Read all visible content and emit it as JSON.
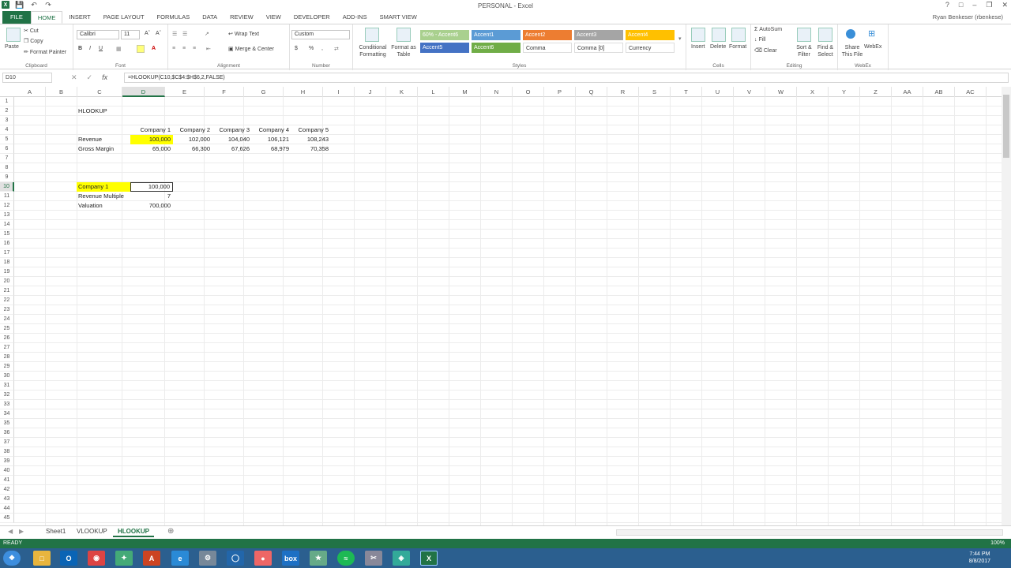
{
  "window": {
    "title": "PERSONAL - Excel",
    "user": "Ryan Benkeser (rbenkese)"
  },
  "ribbon_tabs": [
    "FILE",
    "HOME",
    "INSERT",
    "PAGE LAYOUT",
    "FORMULAS",
    "DATA",
    "REVIEW",
    "VIEW",
    "DEVELOPER",
    "ADD-INS",
    "SMART VIEW"
  ],
  "clipboard": {
    "paste": "Paste",
    "cut": "Cut",
    "copy": "Copy",
    "painter": "Format Painter",
    "label": "Clipboard"
  },
  "font": {
    "name": "Calibri",
    "size": "11",
    "label": "Font",
    "bold": "B",
    "italic": "I",
    "underline": "U",
    "color": "A"
  },
  "alignment": {
    "wrap": "Wrap Text",
    "merge": "Merge & Center",
    "label": "Alignment"
  },
  "number": {
    "format": "Custom",
    "label": "Number",
    "currency": "$",
    "percent": "%",
    "comma": ","
  },
  "styles": {
    "conditional": "Conditional Formatting",
    "format_table": "Format as Table",
    "cells": [
      {
        "label": "60% - Accent6",
        "bg": "#a9d08e",
        "fg": "#ffffff"
      },
      {
        "label": "Accent1",
        "bg": "#5b9bd5",
        "fg": "#ffffff"
      },
      {
        "label": "Accent2",
        "bg": "#ed7d31",
        "fg": "#ffffff"
      },
      {
        "label": "Accent3",
        "bg": "#a5a5a5",
        "fg": "#ffffff"
      },
      {
        "label": "Accent4",
        "bg": "#ffc000",
        "fg": "#ffffff"
      },
      {
        "label": "Accent5",
        "bg": "#4472c4",
        "fg": "#ffffff"
      },
      {
        "label": "Accent6",
        "bg": "#70ad47",
        "fg": "#ffffff"
      },
      {
        "label": "Comma",
        "bg": "#ffffff",
        "fg": "#333333"
      },
      {
        "label": "Comma [0]",
        "bg": "#ffffff",
        "fg": "#333333"
      },
      {
        "label": "Currency",
        "bg": "#ffffff",
        "fg": "#333333"
      }
    ],
    "label": "Styles"
  },
  "cells_group": {
    "insert": "Insert",
    "delete": "Delete",
    "format": "Format",
    "label": "Cells"
  },
  "editing": {
    "autosum": "AutoSum",
    "fill": "Fill",
    "clear": "Clear",
    "sort": "Sort & Filter",
    "find": "Find & Select",
    "label": "Editing"
  },
  "webex": {
    "share": "Share This File",
    "webex": "WebEx",
    "label": "WebEx"
  },
  "formula_bar": {
    "name_box": "D10",
    "fx": "fx",
    "formula": "=HLOOKUP(C10,$C$4:$H$6,2,FALSE)"
  },
  "columns": [
    "A",
    "B",
    "C",
    "D",
    "E",
    "F",
    "G",
    "H",
    "I",
    "J",
    "K",
    "L",
    "M",
    "N",
    "O",
    "P",
    "Q",
    "R",
    "S",
    "T",
    "U",
    "V",
    "W",
    "X",
    "Y",
    "Z",
    "AA",
    "AB",
    "AC"
  ],
  "rows": [
    "1",
    "2",
    "3",
    "4",
    "5",
    "6",
    "7",
    "8",
    "9",
    "10",
    "11",
    "12",
    "13",
    "14",
    "15",
    "16",
    "17",
    "18",
    "19",
    "20",
    "21",
    "22",
    "23",
    "24",
    "25",
    "26",
    "27",
    "28",
    "29",
    "30",
    "31",
    "32",
    "33",
    "34",
    "35",
    "36",
    "37",
    "38",
    "39",
    "40",
    "41",
    "42",
    "43",
    "44",
    "45"
  ],
  "sheet": {
    "title": "HLOOKUP",
    "headers": [
      "Company 1",
      "Company 2",
      "Company 3",
      "Company 4",
      "Company 5"
    ],
    "revenue_label": "Revenue",
    "revenue": [
      "100,000",
      "102,000",
      "104,040",
      "106,121",
      "108,243"
    ],
    "gm_label": "Gross Margin",
    "gross_margin": [
      "65,000",
      "66,300",
      "67,626",
      "68,979",
      "70,358"
    ],
    "lookup_label": "Company 1",
    "lookup_value": "100,000",
    "multiple_label": "Revenue Multiple",
    "multiple_value": "7",
    "valuation_label": "Valuation",
    "valuation_value": "700,000"
  },
  "sheet_tabs": [
    "Sheet1",
    "VLOOKUP",
    "HLOOKUP"
  ],
  "active_sheet": "HLOOKUP",
  "status": {
    "mode": "READY",
    "zoom": "100%"
  },
  "taskbar": {
    "time": "7:44 PM",
    "date": "8/8/2017"
  }
}
